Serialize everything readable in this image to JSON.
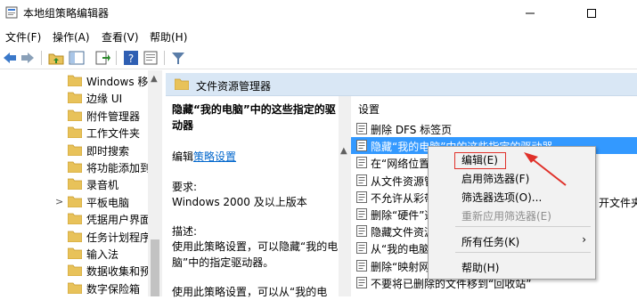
{
  "window": {
    "title": "本地组策略编辑器",
    "min_symbol": "—",
    "max_symbol": "☐"
  },
  "menu": [
    "文件(F)",
    "操作(A)",
    "查看(V)",
    "帮助(H)"
  ],
  "tree": {
    "items": [
      {
        "label": "Windows 移",
        "expandable": false
      },
      {
        "label": "边缘 UI",
        "expandable": false
      },
      {
        "label": "附件管理器",
        "expandable": false
      },
      {
        "label": "工作文件夹",
        "expandable": false
      },
      {
        "label": "即时搜索",
        "expandable": false
      },
      {
        "label": "将功能添加到",
        "expandable": false
      },
      {
        "label": "录音机",
        "expandable": false
      },
      {
        "label": "平板电脑",
        "expandable": true
      },
      {
        "label": "凭据用户界面",
        "expandable": false
      },
      {
        "label": "任务计划程序",
        "expandable": false
      },
      {
        "label": "输入法",
        "expandable": false
      },
      {
        "label": "数据收集和预",
        "expandable": false
      },
      {
        "label": "数字保险箱",
        "expandable": false
      }
    ],
    "expand_glyph": ">",
    "scroll_up": "▲"
  },
  "right_pane": {
    "header": "文件资源管理器",
    "setting_column": "设置"
  },
  "description": {
    "heading": "隐藏“我的电脑”中的这些指定的驱动器",
    "edit_prefix": "编辑",
    "edit_link": "策略设置",
    "requirement_label": "要求:",
    "requirement_value": "Windows 2000 及以上版本",
    "desc_label": "描述:",
    "desc_text": "使用此策略设置，可以隐藏“我的电脑”中的指定驱动器。",
    "desc_text2": "使用此策略设置，可以从“我的电"
  },
  "settings": [
    {
      "label": "删除 DFS 标签页",
      "selected": false
    },
    {
      "label": "隐藏“我的电脑”中的这些指定的驱动器",
      "selected": true
    },
    {
      "label": "在“网络位置",
      "selected": false
    },
    {
      "label": "从文件资源管",
      "selected": false
    },
    {
      "label": "不允许从彩带",
      "selected": false
    },
    {
      "label": "删除“硬件”选",
      "selected": false
    },
    {
      "label": "隐藏文件资源",
      "selected": false
    },
    {
      "label": "从“我的电脑",
      "selected": false
    },
    {
      "label": "删除“映射网",
      "selected": false
    },
    {
      "label": "不要将已删除的文件移到“回收站”",
      "selected": false
    }
  ],
  "settings_right_fragments": {
    "row5": "开文件夹"
  },
  "context_menu": {
    "items": [
      {
        "label": "编辑(E)",
        "disabled": false,
        "highlighted": true
      },
      {
        "label": "启用筛选器(F)",
        "disabled": false
      },
      {
        "label": "筛选器选项(O)...",
        "disabled": false
      },
      {
        "label": "重新应用筛选器(E)",
        "disabled": true
      },
      {
        "label": "所有任务(K)",
        "disabled": false,
        "submenu": true
      },
      {
        "label": "帮助(H)",
        "disabled": false
      }
    ],
    "submenu_arrow": "›"
  },
  "colors": {
    "selection": "#3399ff",
    "header_bg": "#d9e7f5",
    "highlight_box": "#e0312a",
    "link": "#0066cc",
    "folder": "#e8c25a"
  }
}
